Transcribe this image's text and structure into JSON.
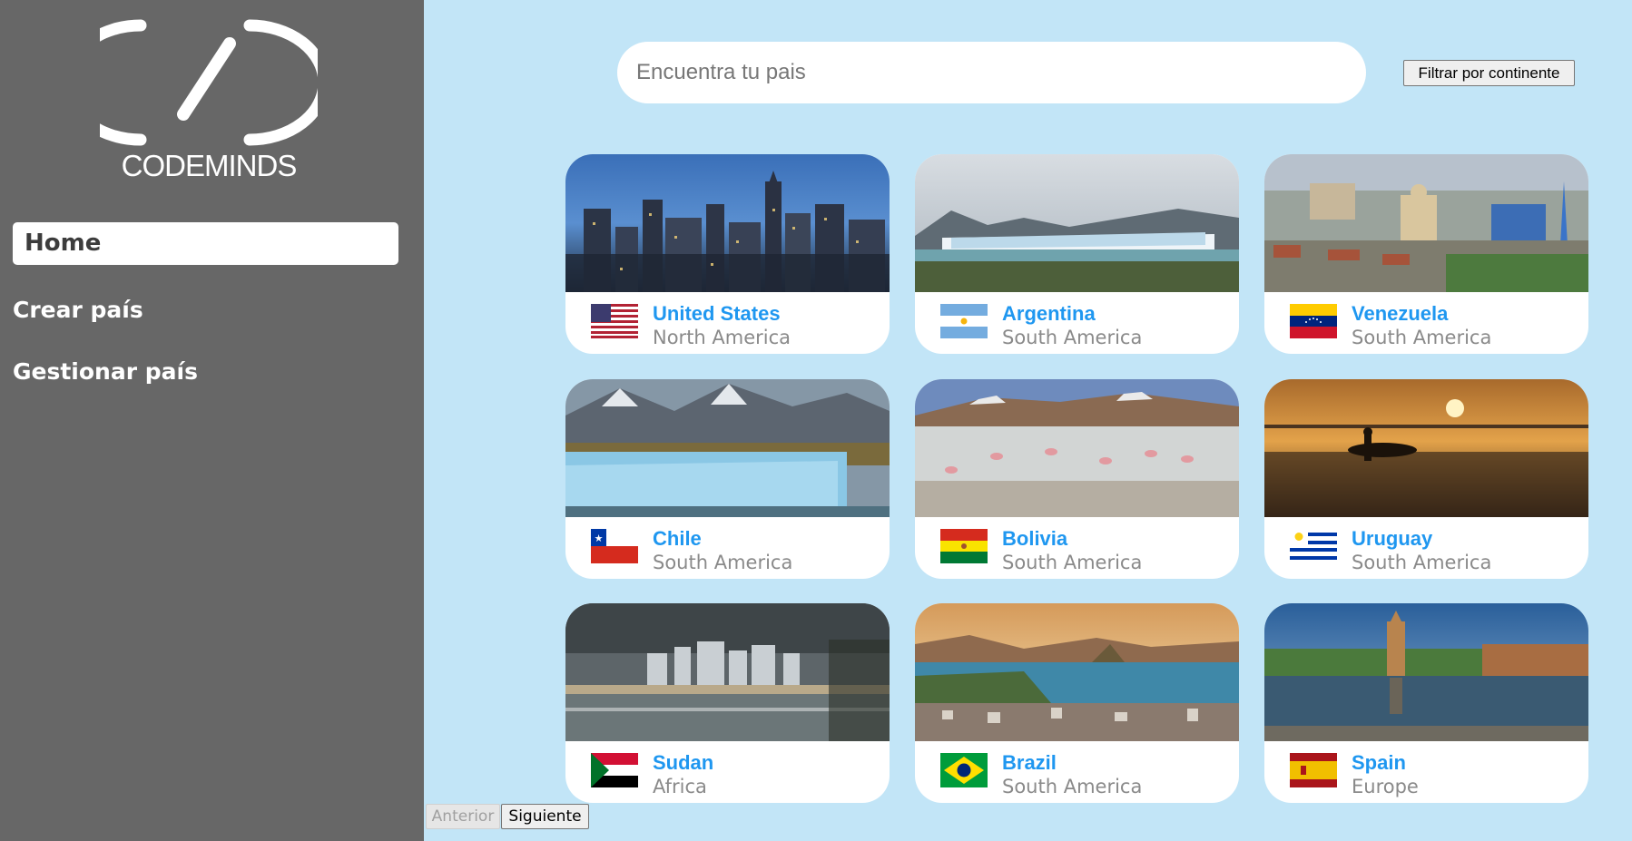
{
  "brand": {
    "name": "CODEMINDS"
  },
  "nav": {
    "home": "Home",
    "create": "Crear país",
    "manage": "Gestionar país"
  },
  "search": {
    "placeholder": "Encuentra tu pais",
    "value": ""
  },
  "filter_button": "Filtrar por continente",
  "countries": [
    {
      "name": "United States",
      "continent": "North America",
      "flag": "flag-us",
      "scene": "city-night-skyline"
    },
    {
      "name": "Argentina",
      "continent": "South America",
      "flag": "flag-ar",
      "scene": "glacier-lake"
    },
    {
      "name": "Venezuela",
      "continent": "South America",
      "flag": "flag-ve",
      "scene": "town-cathedral"
    },
    {
      "name": "Chile",
      "continent": "South America",
      "flag": "flag-cl",
      "scene": "glacier-mountains"
    },
    {
      "name": "Bolivia",
      "continent": "South America",
      "flag": "flag-bo",
      "scene": "flamingo-lagoon"
    },
    {
      "name": "Uruguay",
      "continent": "South America",
      "flag": "flag-uy",
      "scene": "sunset-surfer"
    },
    {
      "name": "Sudan",
      "continent": "Africa",
      "flag": "flag-sd",
      "scene": "coastal-city-storm"
    },
    {
      "name": "Brazil",
      "continent": "South America",
      "flag": "flag-br",
      "scene": "bay-sugarloaf"
    },
    {
      "name": "Spain",
      "continent": "Europe",
      "flag": "flag-es",
      "scene": "plaza-reflection"
    }
  ],
  "pagination": {
    "prev": "Anterior",
    "next": "Siguiente"
  },
  "colors": {
    "sidebar": "#676767",
    "background": "#c2e5f7",
    "country_name": "#1f97f0",
    "continent": "#8a8a8a"
  }
}
